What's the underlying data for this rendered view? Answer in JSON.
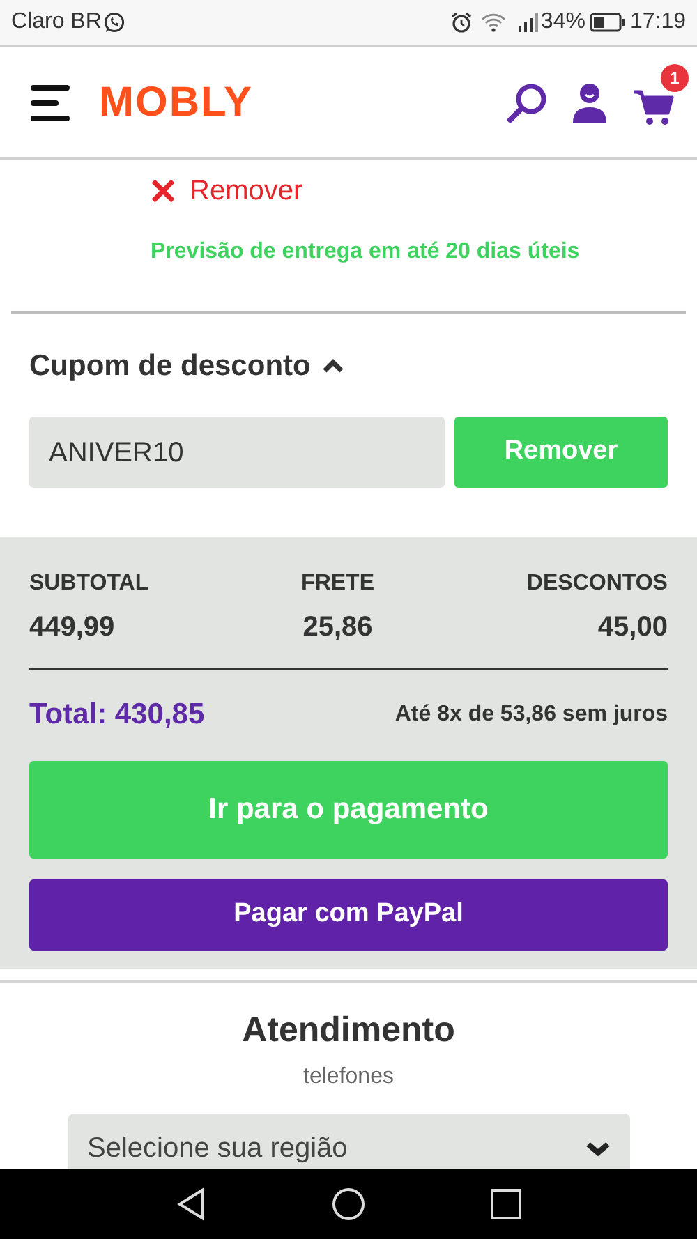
{
  "status_bar": {
    "carrier": "Claro BR",
    "battery": "34%",
    "time": "17:19"
  },
  "header": {
    "logo": "MOBLY",
    "cart_count": "1"
  },
  "item": {
    "remove_label": "Remover",
    "delivery": "Previsão de entrega em até 20 dias úteis"
  },
  "coupon": {
    "title": "Cupom de desconto",
    "expanded": true,
    "value": "ANIVER10",
    "button": "Remover"
  },
  "summary": {
    "columns": [
      {
        "label": "SUBTOTAL",
        "value": "449,99"
      },
      {
        "label": "FRETE",
        "value": "25,86"
      },
      {
        "label": "DESCONTOS",
        "value": "45,00"
      }
    ],
    "total": "Total: 430,85",
    "installments": "Até 8x de 53,86 sem juros",
    "pay_button": "Ir para o pagamento",
    "paypal_button": "Pagar com PayPal"
  },
  "support": {
    "title": "Atendimento",
    "subtitle": "telefones",
    "region_select": "Selecione sua região"
  }
}
